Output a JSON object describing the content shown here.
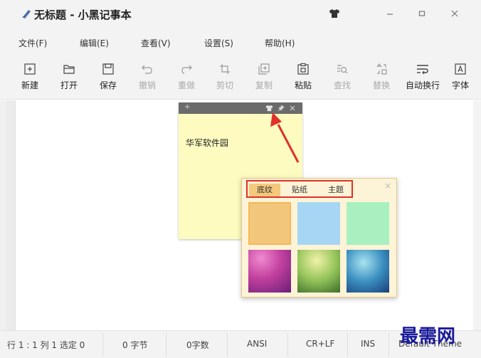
{
  "window": {
    "title": "无标题 - 小黑记事本",
    "skin_icon": "shirt-icon",
    "minimize_icon": "minimize-icon",
    "maximize_icon": "maximize-icon",
    "close_icon": "close-icon"
  },
  "menu": {
    "items": [
      "文件(F)",
      "编辑(E)",
      "查看(V)",
      "设置(S)",
      "帮助(H)"
    ]
  },
  "toolbar": {
    "items": [
      {
        "label": "新建",
        "icon": "new-file-icon",
        "enabled": true
      },
      {
        "label": "打开",
        "icon": "folder-open-icon",
        "enabled": true
      },
      {
        "label": "保存",
        "icon": "save-icon",
        "enabled": true
      },
      {
        "label": "撤销",
        "icon": "undo-icon",
        "enabled": false
      },
      {
        "label": "重做",
        "icon": "redo-icon",
        "enabled": false
      },
      {
        "label": "剪切",
        "icon": "cut-icon",
        "enabled": false
      },
      {
        "label": "复制",
        "icon": "copy-icon",
        "enabled": false
      },
      {
        "label": "粘贴",
        "icon": "paste-icon",
        "enabled": true
      },
      {
        "label": "查找",
        "icon": "find-icon",
        "enabled": false
      },
      {
        "label": "替换",
        "icon": "replace-icon",
        "enabled": false
      },
      {
        "label": "自动换行",
        "icon": "word-wrap-icon",
        "enabled": true
      },
      {
        "label": "字体",
        "icon": "font-icon",
        "enabled": true
      }
    ]
  },
  "sticky_note": {
    "add_symbol": "+",
    "text": "华军软件园",
    "background": "#fdfbbf"
  },
  "skin_popup": {
    "tabs": [
      "底纹",
      "贴纸",
      "主题"
    ],
    "active_tab": "底纹",
    "close_symbol": "×",
    "swatch_colors": [
      "#f2c77c",
      "#a6d6f3",
      "#a8f0c0"
    ],
    "highlight_color": "#e0302a"
  },
  "status": {
    "position": "行 1 : 1  列 1  选定 0",
    "bytes": "0 字节",
    "chars": "0字数",
    "encoding": "ANSI",
    "line_ending": "CR+LF",
    "insert_mode": "INS",
    "theme": "Default Theme"
  },
  "watermark": "最需网"
}
